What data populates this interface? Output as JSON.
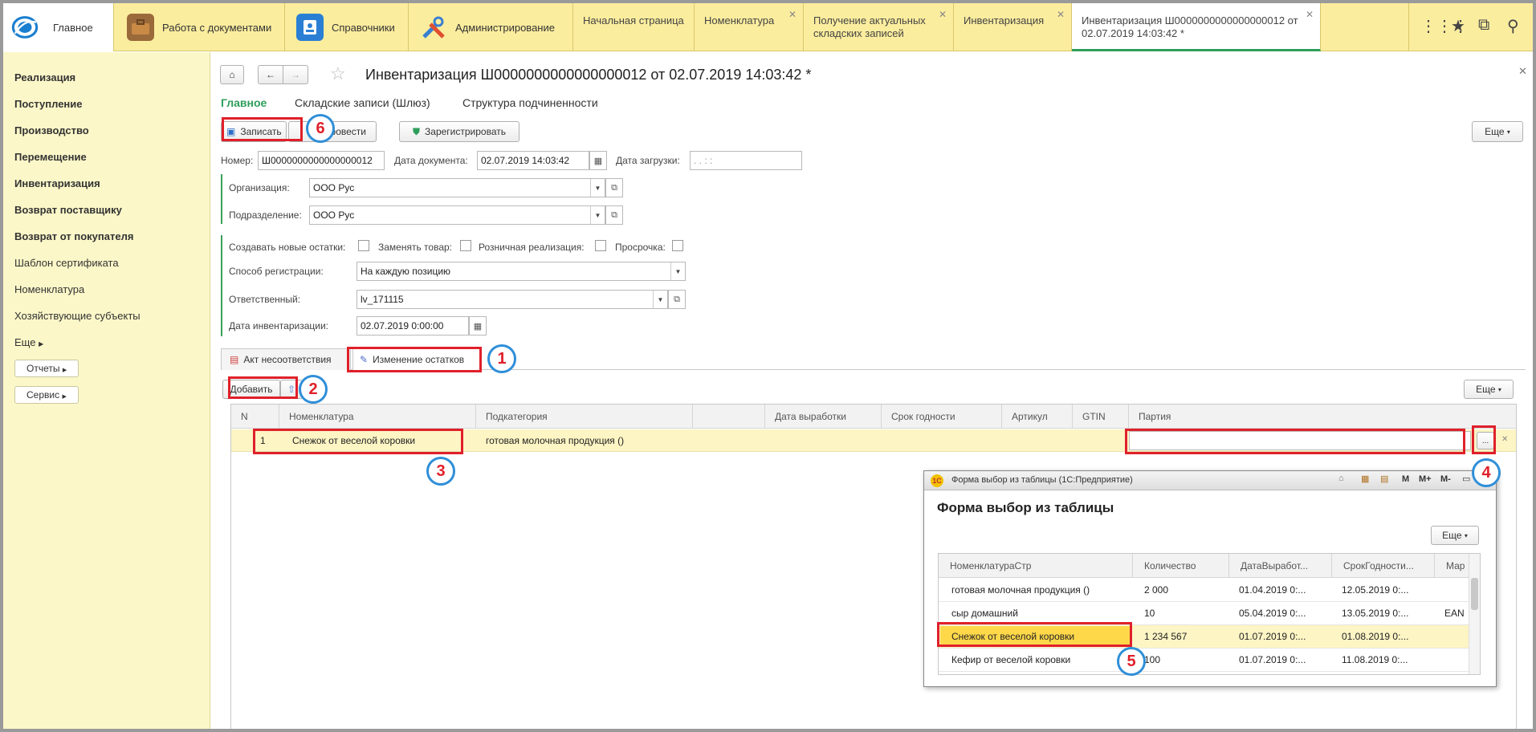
{
  "topbar": {
    "sections": [
      {
        "label": "Главное",
        "icon": "app-logo-icon"
      },
      {
        "label": "Работа с документами",
        "icon": "briefcase-icon"
      },
      {
        "label": "Справочники",
        "icon": "address-book-icon"
      },
      {
        "label": "Администрирование",
        "icon": "tools-icon"
      }
    ],
    "tabs": [
      {
        "label": "Начальная страница"
      },
      {
        "label": "Номенклатура"
      },
      {
        "label": "Получение актуальных складских записей"
      },
      {
        "label": "Инвентаризация"
      },
      {
        "label": "Инвентаризация Ш0000000000000000012 от 02.07.2019 14:03:42 *"
      }
    ]
  },
  "sidebar": {
    "items": [
      {
        "label": "Реализация",
        "bold": true
      },
      {
        "label": "Поступление",
        "bold": true
      },
      {
        "label": "Производство",
        "bold": true
      },
      {
        "label": "Перемещение",
        "bold": true
      },
      {
        "label": "Инвентаризация",
        "bold": true
      },
      {
        "label": "Возврат поставщику",
        "bold": true
      },
      {
        "label": "Возврат от покупателя",
        "bold": true
      },
      {
        "label": "Шаблон сертификата",
        "bold": false
      },
      {
        "label": "Номенклатура",
        "bold": false
      },
      {
        "label": "Хозяйствующие субъекты",
        "bold": false
      },
      {
        "label": "Еще",
        "bold": false
      }
    ],
    "reports_label": "Отчеты",
    "service_label": "Сервис"
  },
  "document": {
    "title": "Инвентаризация Ш0000000000000000012 от 02.07.2019 14:03:42 *",
    "nav": [
      "Главное",
      "Складские записи (Шлюз)",
      "Структура подчиненности"
    ],
    "toolbar": {
      "save": "Записать",
      "post": "Провести",
      "register": "Зарегистрировать",
      "more": "Еще"
    },
    "fields": {
      "number_label": "Номер:",
      "number": "Ш0000000000000000012",
      "date_label": "Дата документа:",
      "date": "02.07.2019 14:03:42",
      "load_label": "Дата загрузки:",
      "load": " .  .      :  :",
      "org_label": "Организация:",
      "org": "ООО Рус",
      "dept_label": "Подразделение:",
      "dept": "ООО Рус",
      "create_rest_label": "Создавать новые остатки:",
      "replace_label": "Заменять товар:",
      "retail_label": "Розничная реализация:",
      "overdue_label": "Просрочка:",
      "reg_method_label": "Способ регистрации:",
      "reg_method": "На каждую позицию",
      "resp_label": "Ответственный:",
      "resp": "lv_171115",
      "inv_date_label": "Дата инвентаризации:",
      "inv_date": "02.07.2019  0:00:00"
    },
    "tabs": [
      "Акт несоответствия",
      "Изменение остатков"
    ],
    "table_toolbar": {
      "add": "Добавить",
      "more": "Еще"
    },
    "table": {
      "headers": [
        "N",
        "Номенклатура",
        "Подкатегория",
        "",
        "Дата выработки",
        "Срок годности",
        "Артикул",
        "GTIN",
        "Партия"
      ],
      "rows": [
        {
          "n": "1",
          "nom": "Снежок от веселой коровки",
          "sub": "готовая молочная продукция ()"
        }
      ],
      "select_btn": "..."
    }
  },
  "popup": {
    "window_title": "Форма выбор из таблицы  (1С:Предприятие)",
    "heading": "Форма выбор из таблицы",
    "more": "Еще",
    "title_buttons": [
      "M",
      "M+",
      "M-"
    ],
    "headers": [
      "НоменклатураСтр",
      "Количество",
      "ДатаВыработ...",
      "СрокГодности...",
      "Мар"
    ],
    "rows": [
      {
        "name": "готовая молочная продукция ()",
        "qty": "2 000",
        "prod": "01.04.2019 0:...",
        "exp": "12.05.2019 0:...",
        "mark": ""
      },
      {
        "name": "сыр домашний",
        "qty": "10",
        "prod": "05.04.2019 0:...",
        "exp": "13.05.2019 0:...",
        "mark": "EAN"
      },
      {
        "name": "Снежок от веселой коровки",
        "qty": "1 234 567",
        "prod": "01.07.2019 0:...",
        "exp": "01.08.2019 0:...",
        "mark": ""
      },
      {
        "name": "Кефир от веселой коровки",
        "qty": "100",
        "prod": "01.07.2019 0:...",
        "exp": "11.08.2019 0:...",
        "mark": ""
      }
    ]
  },
  "annotations": [
    "1",
    "2",
    "3",
    "4",
    "5",
    "6"
  ],
  "colors": {
    "topbar": "#fbed9e",
    "sidebar": "#fbf7c8",
    "accent": "#2e9e5b",
    "highlight": "#e0202a",
    "marker": "#2f8fd8",
    "selected_row": "#fdf5c4",
    "selected_cell": "#ffd84a"
  }
}
